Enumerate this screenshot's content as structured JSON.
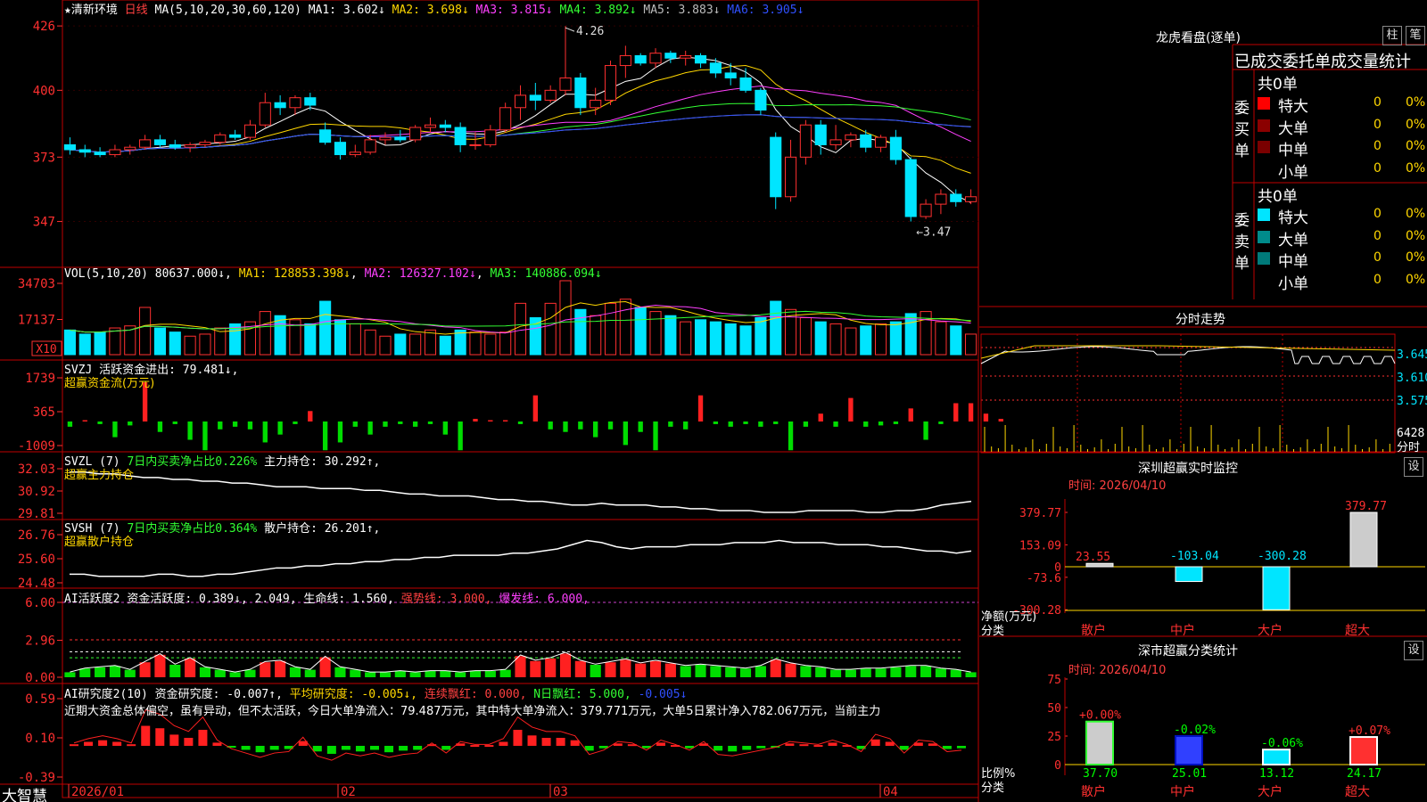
{
  "stock": {
    "name": "★清新环境",
    "period": "日线",
    "ma_label": "MA(5,10,20,30,60,120)",
    "ma_values": [
      {
        "label": "MA1:",
        "value": "3.602↓",
        "color": "#ffffff"
      },
      {
        "label": "MA2:",
        "value": "3.698↓",
        "color": "#ffd700"
      },
      {
        "label": "MA3:",
        "value": "3.815↓",
        "color": "#ff40ff"
      },
      {
        "label": "MA4:",
        "value": "3.892↓",
        "color": "#33ff33"
      },
      {
        "label": "MA5:",
        "value": "3.883↓",
        "color": "#bbbbbb"
      },
      {
        "label": "MA6:",
        "value": "3.905↓",
        "color": "#3050ff"
      }
    ],
    "high_label": "4.26",
    "low_label": "←3.47"
  },
  "price_axis": [
    "426",
    "400",
    "373",
    "347"
  ],
  "vol": {
    "label": "VOL(5,10,20)",
    "value": "80637.000↓",
    "ma1": "MA1: 128853.398↓",
    "ma2": "MA2: 126327.102↓",
    "ma3": "MA3: 140886.094↓",
    "axis": [
      "34703",
      "17137"
    ],
    "unit": "X10"
  },
  "svzj": {
    "label": "SVZJ",
    "desc": "活跃资金进出: 79.481↓,",
    "sub": "超赢资金流(万元)",
    "axis": [
      "1739",
      "365",
      "-1009"
    ]
  },
  "svzl": {
    "label": "SVZL (7)",
    "desc1": "7日内买卖净占比0.226%",
    "desc2": "主力持仓: 30.292↑,",
    "sub": "超赢主力持仓",
    "axis": [
      "32.03",
      "30.92",
      "29.81"
    ]
  },
  "svsh": {
    "label": "SVSH (7)",
    "desc1": "7日内买卖净占比0.364%",
    "desc2": "散户持仓: 26.201↑,",
    "sub": "超赢散户持仓",
    "axis": [
      "26.76",
      "25.60",
      "24.48"
    ]
  },
  "ai1": {
    "label": "AI活跃度2",
    "desc1": "资金活跃度: 0.389↓, 2.049, 生命线: 1.560,",
    "desc2": "强势线: 3.000,",
    "desc3": "爆发线: 6.000,",
    "axis": [
      "6.00",
      "2.96",
      "0.00"
    ]
  },
  "ai2": {
    "label": "AI研究度2(10)",
    "desc1": "资金研究度: -0.007↑,",
    "desc2": "平均研究度: -0.005↓,",
    "desc3": "连续飘红: 0.000,",
    "desc4": "N日飘红: 5.000,",
    "desc5": "-0.005↓",
    "comment": "近期大资金总体偏空，虽有异动，但不太活跃，今日大单净流入：79.487万元，其中特大单净流入：379.771万元，大单5日累计净入782.067万元，当前主力",
    "axis": [
      "0.59",
      "0.10",
      "-0.39"
    ]
  },
  "dates": [
    "2026/01",
    "02",
    "03",
    "04"
  ],
  "brand": "大智慧",
  "lhb": {
    "title": "龙虎看盘(逐单)",
    "btn1": "柱",
    "btn2": "笔",
    "header": "已成交委托单成交量统计",
    "buy_label": "委买单",
    "sell_label": "委卖单",
    "buy_total": "共0单",
    "sell_total": "共0单",
    "rows": [
      "特大",
      "大单",
      "中单",
      "小单"
    ],
    "buy_colors": [
      "#ff0000",
      "#8b0000",
      "#7a0000",
      "#000000"
    ],
    "sell_colors": [
      "#00e5ff",
      "#008b8b",
      "#007a7a",
      "#000000"
    ],
    "zero": "0",
    "pct": "0%"
  },
  "fs": {
    "title": "分时走势",
    "axis": [
      "3.645",
      "3.610",
      "3.575"
    ],
    "vol": "6428",
    "vol_label": "分时"
  },
  "sz_monitor": {
    "title": "深圳超赢实时监控",
    "btn": "设",
    "time": "时间: 2026/04/10",
    "axis": [
      "379.77",
      "153.09",
      "0",
      "-73.6",
      "-300.28"
    ],
    "ylabel": "净额(万元)",
    "xlabel": "分类",
    "categories": [
      "散户",
      "中户",
      "大户",
      "超大"
    ],
    "value_labels": [
      "23.55",
      "-103.04",
      "-300.28",
      "379.77"
    ]
  },
  "sz_class": {
    "title": "深市超赢分类统计",
    "btn": "设",
    "time": "时间: 2026/04/10",
    "axis": [
      "75",
      "50",
      "25",
      "0"
    ],
    "ylabel": "比例%",
    "xlabel": "分类",
    "categories": [
      "散户",
      "中户",
      "大户",
      "超大"
    ],
    "change_labels": [
      "+0.00%",
      "-0.02%",
      "-0.06%",
      "+0.07%"
    ],
    "bottom_labels": [
      "37.70",
      "25.01",
      "13.12",
      "24.17"
    ]
  },
  "chart_data": [
    {
      "type": "candlestick",
      "title": "★清新环境 日线",
      "ylim": [
        3.47,
        4.26
      ],
      "ohlc": [
        [
          3.78,
          3.81,
          3.74,
          3.76
        ],
        [
          3.76,
          3.78,
          3.73,
          3.75
        ],
        [
          3.75,
          3.77,
          3.73,
          3.74
        ],
        [
          3.74,
          3.78,
          3.73,
          3.76
        ],
        [
          3.76,
          3.78,
          3.74,
          3.77
        ],
        [
          3.77,
          3.82,
          3.76,
          3.8
        ],
        [
          3.8,
          3.82,
          3.77,
          3.78
        ],
        [
          3.78,
          3.8,
          3.76,
          3.77
        ],
        [
          3.77,
          3.79,
          3.75,
          3.78
        ],
        [
          3.78,
          3.8,
          3.77,
          3.79
        ],
        [
          3.79,
          3.83,
          3.78,
          3.82
        ],
        [
          3.82,
          3.84,
          3.8,
          3.81
        ],
        [
          3.81,
          3.88,
          3.8,
          3.86
        ],
        [
          3.86,
          3.99,
          3.85,
          3.95
        ],
        [
          3.95,
          3.98,
          3.9,
          3.93
        ],
        [
          3.93,
          3.98,
          3.9,
          3.97
        ],
        [
          3.97,
          3.99,
          3.92,
          3.94
        ],
        [
          3.84,
          3.87,
          3.78,
          3.79
        ],
        [
          3.79,
          3.81,
          3.72,
          3.74
        ],
        [
          3.74,
          3.78,
          3.73,
          3.75
        ],
        [
          3.75,
          3.82,
          3.74,
          3.8
        ],
        [
          3.8,
          3.83,
          3.78,
          3.81
        ],
        [
          3.81,
          3.84,
          3.79,
          3.8
        ],
        [
          3.8,
          3.86,
          3.79,
          3.85
        ],
        [
          3.85,
          3.89,
          3.83,
          3.86
        ],
        [
          3.86,
          3.88,
          3.83,
          3.85
        ],
        [
          3.85,
          3.87,
          3.75,
          3.78
        ],
        [
          3.78,
          3.83,
          3.76,
          3.78
        ],
        [
          3.78,
          3.86,
          3.77,
          3.84
        ],
        [
          3.84,
          3.95,
          3.83,
          3.93
        ],
        [
          3.93,
          4.02,
          3.88,
          3.98
        ],
        [
          3.98,
          4.03,
          3.92,
          3.96
        ],
        [
          3.96,
          4.02,
          3.95,
          4.0
        ],
        [
          4.0,
          4.26,
          3.98,
          4.05
        ],
        [
          4.05,
          4.07,
          3.9,
          3.93
        ],
        [
          3.93,
          4.01,
          3.9,
          3.96
        ],
        [
          3.96,
          4.12,
          3.94,
          4.1
        ],
        [
          4.1,
          4.18,
          4.05,
          4.14
        ],
        [
          4.14,
          4.15,
          4.1,
          4.11
        ],
        [
          4.11,
          4.17,
          4.09,
          4.15
        ],
        [
          4.15,
          4.16,
          4.11,
          4.13
        ],
        [
          4.13,
          4.16,
          4.1,
          4.14
        ],
        [
          4.14,
          4.15,
          4.09,
          4.11
        ],
        [
          4.11,
          4.13,
          4.05,
          4.07
        ],
        [
          4.07,
          4.11,
          4.02,
          4.05
        ],
        [
          4.05,
          4.09,
          3.99,
          4.0
        ],
        [
          4.0,
          4.01,
          3.9,
          3.92
        ],
        [
          3.81,
          3.83,
          3.52,
          3.57
        ],
        [
          3.57,
          3.8,
          3.55,
          3.73
        ],
        [
          3.73,
          3.88,
          3.7,
          3.86
        ],
        [
          3.86,
          3.88,
          3.74,
          3.78
        ],
        [
          3.78,
          3.86,
          3.76,
          3.8
        ],
        [
          3.8,
          3.83,
          3.77,
          3.82
        ],
        [
          3.82,
          3.84,
          3.75,
          3.77
        ],
        [
          3.77,
          3.82,
          3.75,
          3.81
        ],
        [
          3.81,
          3.84,
          3.7,
          3.72
        ],
        [
          3.72,
          3.73,
          3.47,
          3.49
        ],
        [
          3.49,
          3.56,
          3.48,
          3.54
        ],
        [
          3.54,
          3.6,
          3.5,
          3.58
        ],
        [
          3.58,
          3.6,
          3.53,
          3.55
        ],
        [
          3.55,
          3.6,
          3.54,
          3.57
        ]
      ]
    },
    {
      "type": "bar",
      "title": "VOL(5,10,20)",
      "unit": "X10",
      "values": [
        12000,
        10000,
        11000,
        13000,
        14000,
        23000,
        13000,
        11000,
        9000,
        10000,
        13000,
        15000,
        16000,
        21000,
        19000,
        17000,
        15000,
        26000,
        17000,
        15000,
        12000,
        9000,
        10000,
        10000,
        12000,
        9000,
        12000,
        11000,
        10000,
        11000,
        25000,
        18000,
        25000,
        36000,
        22000,
        19000,
        25000,
        27000,
        23000,
        21000,
        19000,
        16000,
        17000,
        16000,
        15000,
        14000,
        18000,
        26000,
        22000,
        18000,
        16000,
        15000,
        13000,
        14000,
        15000,
        16000,
        20000,
        21000,
        16000,
        14000,
        10000
      ],
      "ylim": [
        0,
        34703
      ]
    },
    {
      "type": "bar",
      "title": "SVZJ 超赢资金流(万元)",
      "values": [
        -200,
        50,
        -100,
        -600,
        -150,
        1500,
        -400,
        -100,
        -700,
        -1100,
        -300,
        -200,
        -300,
        -800,
        -500,
        -100,
        400,
        -1100,
        -800,
        -200,
        -500,
        -200,
        -100,
        -200,
        -100,
        -500,
        -1100,
        100,
        50,
        50,
        -100,
        1000,
        -300,
        -400,
        -300,
        -600,
        -300,
        -900,
        -400,
        -1100,
        -200,
        -300,
        1000,
        -100,
        -200,
        -100,
        -200,
        -100,
        -1100,
        -200,
        300,
        -200,
        900,
        -200,
        -150,
        -100,
        500,
        -700,
        -100,
        700,
        700,
        300,
        100
      ],
      "ylim": [
        -1009,
        1739
      ]
    },
    {
      "type": "line",
      "title": "SVZL 超赢主力持仓",
      "values": [
        31.8,
        31.8,
        31.7,
        31.7,
        31.6,
        31.5,
        31.5,
        31.4,
        31.4,
        31.3,
        31.3,
        31.2,
        31.2,
        31.1,
        31.0,
        31.0,
        31.0,
        30.9,
        30.9,
        30.9,
        30.8,
        30.8,
        30.7,
        30.6,
        30.6,
        30.5,
        30.5,
        30.5,
        30.4,
        30.3,
        30.3,
        30.2,
        30.2,
        30.1,
        30.0,
        30.0,
        30.1,
        30.0,
        30.0,
        30.0,
        29.9,
        29.9,
        29.8,
        29.8,
        29.7,
        29.7,
        29.7,
        29.6,
        29.6,
        29.6,
        29.7,
        29.7,
        29.7,
        29.7,
        29.6,
        29.6,
        29.7,
        29.7,
        29.8,
        30.0,
        30.1,
        30.2
      ],
      "ylim": [
        29.81,
        32.03
      ]
    },
    {
      "type": "line",
      "title": "SVSH 超赢散户持仓",
      "values": [
        24.8,
        24.8,
        24.7,
        24.7,
        24.7,
        24.7,
        24.8,
        24.8,
        24.7,
        24.7,
        24.8,
        24.8,
        24.9,
        25.0,
        25.1,
        25.1,
        25.2,
        25.2,
        25.3,
        25.3,
        25.4,
        25.4,
        25.5,
        25.5,
        25.6,
        25.6,
        25.7,
        25.7,
        25.7,
        25.7,
        25.8,
        25.8,
        25.9,
        26.0,
        26.2,
        26.4,
        26.3,
        26.1,
        26.0,
        26.1,
        26.1,
        26.1,
        26.2,
        26.2,
        26.2,
        26.3,
        26.3,
        26.3,
        26.4,
        26.3,
        26.3,
        26.3,
        26.2,
        26.2,
        26.2,
        26.1,
        26.1,
        26.0,
        25.9,
        25.9,
        25.8,
        25.9
      ],
      "ylim": [
        24.48,
        26.76
      ]
    },
    {
      "type": "bar",
      "title": "AI活跃度2",
      "values": [
        0.4,
        0.7,
        0.8,
        0.9,
        0.6,
        1.2,
        1.8,
        1.0,
        1.5,
        0.8,
        0.6,
        0.4,
        0.6,
        1.2,
        1.3,
        0.8,
        0.6,
        1.6,
        0.8,
        0.6,
        0.4,
        0.4,
        0.5,
        0.4,
        0.5,
        0.5,
        0.4,
        0.5,
        0.5,
        0.6,
        1.7,
        1.3,
        1.5,
        1.9,
        1.3,
        1.0,
        1.2,
        1.4,
        1.1,
        1.3,
        1.1,
        0.9,
        1.0,
        0.9,
        0.8,
        0.7,
        0.9,
        1.4,
        1.1,
        0.9,
        0.8,
        0.6,
        0.6,
        0.7,
        0.7,
        0.8,
        0.9,
        0.9,
        0.7,
        0.6,
        0.4
      ],
      "lines": [
        1.56,
        2.049,
        3.0,
        6.0
      ],
      "ylim": [
        0,
        6
      ]
    },
    {
      "type": "bar",
      "title": "AI研究度2(10)",
      "values": [
        0.02,
        0.05,
        0.07,
        0.05,
        0.02,
        0.25,
        0.22,
        0.14,
        0.1,
        0.2,
        0.04,
        -0.02,
        -0.05,
        -0.08,
        -0.05,
        -0.04,
        0.06,
        -0.07,
        -0.1,
        -0.05,
        -0.07,
        -0.05,
        -0.08,
        -0.06,
        -0.05,
        0.02,
        -0.05,
        0.03,
        0.01,
        0.01,
        0.05,
        0.2,
        0.13,
        0.1,
        0.1,
        0.07,
        -0.06,
        -0.03,
        0.03,
        0.02,
        -0.03,
        0.04,
        0.01,
        -0.03,
        0.03,
        -0.06,
        -0.07,
        -0.05,
        -0.03,
        -0.01,
        0.03,
        0.02,
        0.01,
        0.04,
        0.01,
        -0.04,
        0.08,
        0.05,
        -0.05,
        0.04,
        0.03,
        -0.04,
        -0.03
      ],
      "ylim": [
        -0.39,
        0.59
      ]
    },
    {
      "type": "bar",
      "title": "深圳超赢实时监控",
      "categories": [
        "散户",
        "中户",
        "大户",
        "超大"
      ],
      "values": [
        23.55,
        -103.04,
        -300.28,
        379.77
      ],
      "ylabel": "净额(万元)"
    },
    {
      "type": "bar",
      "title": "深市超赢分类统计",
      "categories": [
        "散户",
        "中户",
        "大户",
        "超大"
      ],
      "values": [
        37.7,
        25.01,
        13.12,
        24.17
      ],
      "ylabel": "比例%",
      "ylim": [
        0,
        75
      ]
    }
  ]
}
